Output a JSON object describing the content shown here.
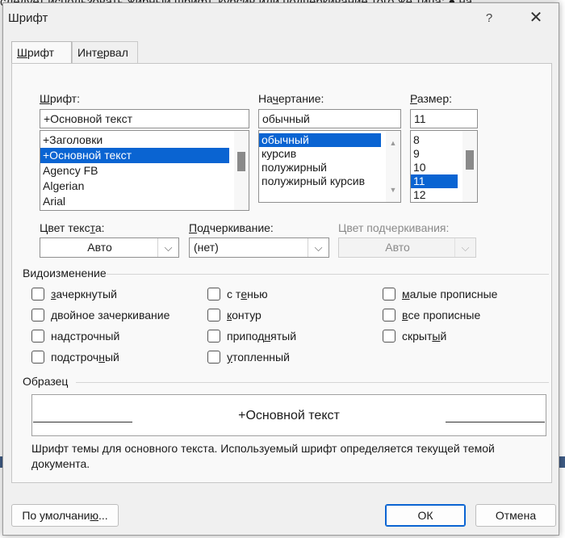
{
  "background_doc": {
    "top_line": "следует использовать жирный шрифт, курсив или подчеркивание того же типа: ● на"
  },
  "dialog": {
    "title": "Шрифт",
    "help_label": "?",
    "close_label": "✕",
    "tabs": [
      {
        "label_u": "Ш",
        "label_rest": "рифт",
        "active": true
      },
      {
        "label_pre": "Инт",
        "label_u": "е",
        "label_rest": "рвал",
        "active": false
      }
    ],
    "font": {
      "label_u": "Ш",
      "label_rest": "рифт:",
      "value": "+Основной текст",
      "list": [
        "+Заголовки",
        "+Основной текст",
        "Agency FB",
        "Algerian",
        "Arial"
      ],
      "selected_index": 1
    },
    "style": {
      "label_pre": "На",
      "label_u": "ч",
      "label_rest": "ертание:",
      "value": "обычный",
      "list": [
        "обычный",
        "курсив",
        "полужирный",
        "полужирный курсив"
      ],
      "selected_index": 0
    },
    "size": {
      "label_u": "Р",
      "label_rest": "азмер:",
      "value": "11",
      "list": [
        "8",
        "9",
        "10",
        "11",
        "12"
      ],
      "selected_index": 3
    },
    "text_color": {
      "label_pre": "Цвет текс",
      "label_u": "т",
      "label_rest": "а:",
      "value": "Авто"
    },
    "underline": {
      "label_u": "П",
      "label_rest": "одчеркивание:",
      "value": "(нет)"
    },
    "underline_color": {
      "label": "Цвет подчеркивания:",
      "value": "Авто"
    },
    "effects_title": "Видоизменение",
    "effects": {
      "col1": [
        {
          "pre": "",
          "u": "з",
          "rest": "ачеркнутый"
        },
        {
          "pre": "",
          "u": "д",
          "rest": "войное зачеркивание"
        },
        {
          "pre": "на",
          "u": "д",
          "rest": "строчный"
        },
        {
          "pre": "подстроч",
          "u": "н",
          "rest": "ый"
        }
      ],
      "col2": [
        {
          "pre": "с т",
          "u": "е",
          "rest": "нью"
        },
        {
          "pre": "",
          "u": "к",
          "rest": "онтур"
        },
        {
          "pre": "припод",
          "u": "н",
          "rest": "ятый"
        },
        {
          "pre": "",
          "u": "у",
          "rest": "топленный"
        }
      ],
      "col3": [
        {
          "pre": "",
          "u": "м",
          "rest": "алые прописные"
        },
        {
          "pre": "",
          "u": "в",
          "rest": "се прописные"
        },
        {
          "pre": "скрыт",
          "u": "ы",
          "rest": "й"
        }
      ]
    },
    "preview_title": "Образец",
    "preview_text": "+Основной текст",
    "description": "Шрифт темы для основного текста. Используемый шрифт определяется текущей темой документа.",
    "buttons": {
      "default_pre": "По умолчани",
      "default_u": "ю",
      "default_rest": "...",
      "ok": "ОК",
      "cancel": "Отмена"
    }
  },
  "colors": {
    "selection": "#0a64d2",
    "dialog_bg": "#f0f0f0",
    "panel_bg": "#f9f9f9"
  }
}
